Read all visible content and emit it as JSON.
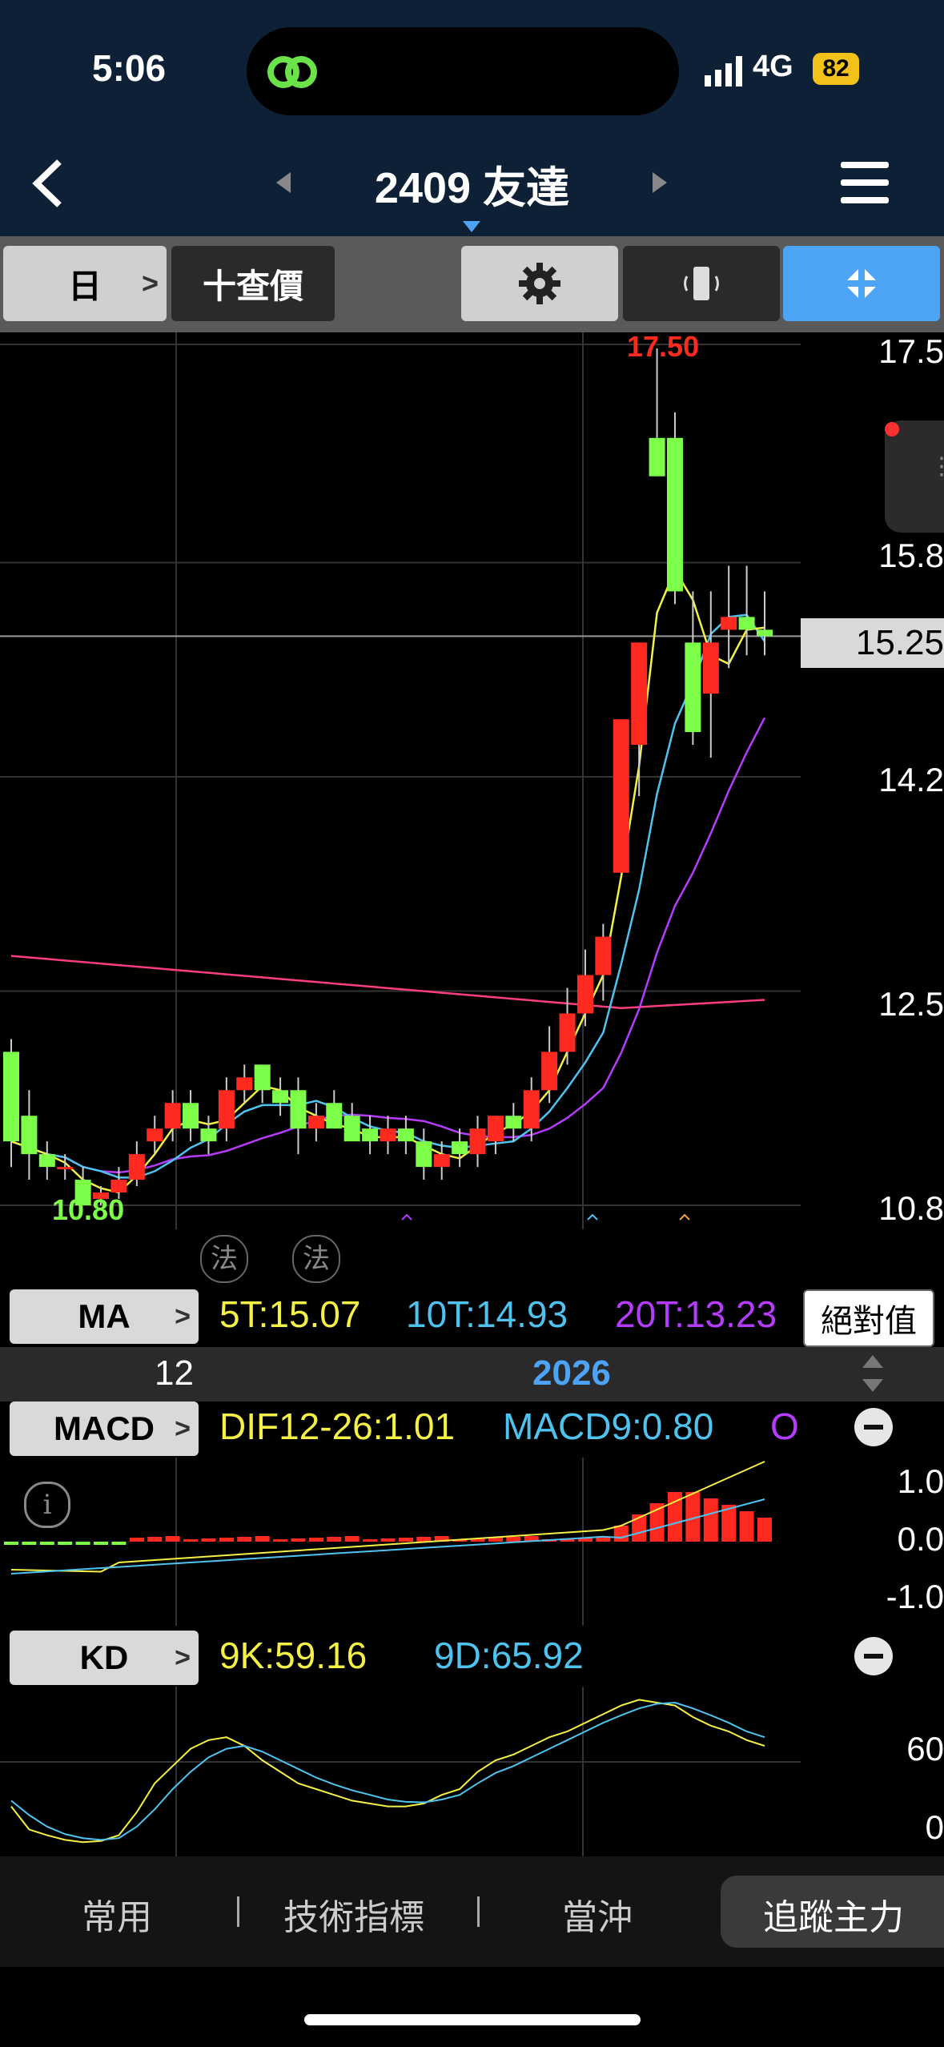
{
  "status": {
    "time": "5:06",
    "network": "4G",
    "battery": "82"
  },
  "header": {
    "title": "2409 友達"
  },
  "toolbar": {
    "period": "日",
    "query_price": "十查價"
  },
  "price_axis": {
    "labels": [
      "17.5",
      "15.8",
      "14.2",
      "12.5",
      "10.8"
    ],
    "current_price": "15.25",
    "high_label": "17.50",
    "low_label": "10.80"
  },
  "law_badges": [
    "法",
    "法"
  ],
  "ma": {
    "label": "MA",
    "ma5": "5T:15.07",
    "ma10": "10T:14.93",
    "ma20": "20T:13.23",
    "abs_button": "絕對值"
  },
  "dates": {
    "left": "12",
    "right": "2026"
  },
  "macd": {
    "label": "MACD",
    "dif": "DIF12-26:1.01",
    "macd": "MACD9:0.80",
    "osc": "O",
    "axis": [
      "1.0",
      "0.0",
      "-1.0"
    ]
  },
  "kd": {
    "label": "KD",
    "k": "9K:59.16",
    "d": "9D:65.92",
    "axis": [
      "60",
      "0"
    ]
  },
  "bottom_nav": [
    "常用",
    "技術指標",
    "當沖",
    "追蹤主力"
  ],
  "colors": {
    "up": "#ff2a1f",
    "down": "#7dff4a",
    "ma5": "#f5f045",
    "ma10": "#4fc3ef",
    "ma20": "#b53cff",
    "ma60": "#ff3d7f",
    "accent": "#4da3f5"
  },
  "chart_data": {
    "type": "candlestick",
    "candles": [
      [
        12.0,
        12.1,
        11.1,
        11.3
      ],
      [
        11.5,
        11.7,
        11.0,
        11.2
      ],
      [
        11.2,
        11.3,
        11.0,
        11.1
      ],
      [
        11.1,
        11.2,
        11.0,
        11.1
      ],
      [
        11.0,
        11.1,
        10.8,
        10.8
      ],
      [
        10.85,
        10.95,
        10.8,
        10.9
      ],
      [
        10.9,
        11.1,
        10.85,
        11.0
      ],
      [
        11.0,
        11.3,
        10.95,
        11.2
      ],
      [
        11.3,
        11.5,
        11.2,
        11.4
      ],
      [
        11.4,
        11.7,
        11.3,
        11.6
      ],
      [
        11.6,
        11.7,
        11.3,
        11.4
      ],
      [
        11.4,
        11.5,
        11.2,
        11.3
      ],
      [
        11.4,
        11.8,
        11.3,
        11.7
      ],
      [
        11.7,
        11.9,
        11.6,
        11.8
      ],
      [
        11.9,
        11.9,
        11.6,
        11.7
      ],
      [
        11.7,
        11.8,
        11.5,
        11.6
      ],
      [
        11.7,
        11.8,
        11.2,
        11.4
      ],
      [
        11.4,
        11.6,
        11.3,
        11.5
      ],
      [
        11.6,
        11.7,
        11.4,
        11.4
      ],
      [
        11.5,
        11.6,
        11.3,
        11.3
      ],
      [
        11.4,
        11.5,
        11.2,
        11.3
      ],
      [
        11.3,
        11.5,
        11.2,
        11.4
      ],
      [
        11.4,
        11.5,
        11.2,
        11.3
      ],
      [
        11.3,
        11.4,
        11.0,
        11.1
      ],
      [
        11.1,
        11.3,
        11.0,
        11.2
      ],
      [
        11.3,
        11.4,
        11.1,
        11.2
      ],
      [
        11.2,
        11.5,
        11.1,
        11.4
      ],
      [
        11.3,
        11.5,
        11.2,
        11.5
      ],
      [
        11.5,
        11.6,
        11.3,
        11.4
      ],
      [
        11.4,
        11.8,
        11.3,
        11.7
      ],
      [
        11.7,
        12.2,
        11.6,
        12.0
      ],
      [
        12.0,
        12.5,
        11.9,
        12.3
      ],
      [
        12.3,
        12.8,
        12.2,
        12.6
      ],
      [
        12.6,
        13.0,
        12.4,
        12.9
      ],
      [
        13.4,
        14.6,
        13.4,
        14.6
      ],
      [
        14.4,
        15.2,
        14.0,
        15.2
      ],
      [
        16.8,
        17.5,
        16.8,
        16.5
      ],
      [
        16.8,
        17.0,
        15.5,
        15.6
      ],
      [
        15.2,
        15.6,
        14.4,
        14.5
      ],
      [
        14.8,
        15.6,
        14.3,
        15.2
      ],
      [
        15.3,
        15.8,
        15.0,
        15.4
      ],
      [
        15.4,
        15.8,
        15.1,
        15.3
      ],
      [
        15.3,
        15.6,
        15.1,
        15.25
      ]
    ],
    "ylim": [
      10.8,
      17.5
    ]
  }
}
